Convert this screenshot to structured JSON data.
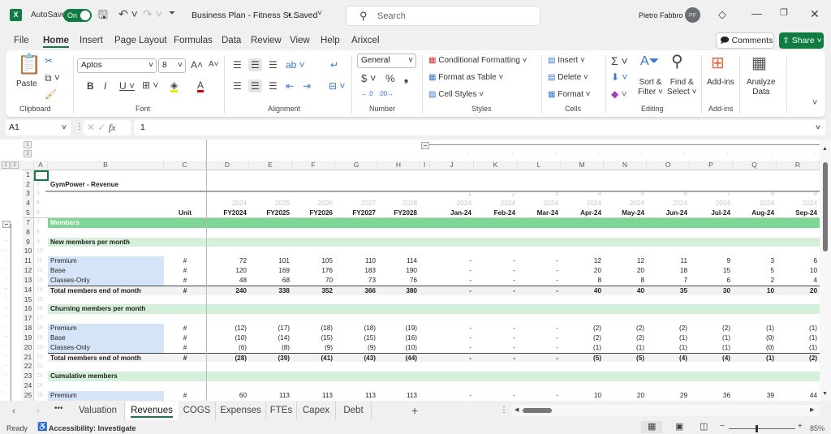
{
  "titlebar": {
    "autosave": "AutoSave",
    "toggle": "On",
    "doc_title": "Business Plan - Fitness St...",
    "saved": "• Saved",
    "search_placeholder": "Search",
    "user": "Pietro Fabbro",
    "initials": "PF"
  },
  "menu": [
    "File",
    "Home",
    "Insert",
    "Page Layout",
    "Formulas",
    "Data",
    "Review",
    "View",
    "Help",
    "Arixcel"
  ],
  "menu_active": "Home",
  "actions": {
    "comments": "Comments",
    "share": "Share"
  },
  "ribbon": {
    "clipboard": {
      "paste": "Paste",
      "label": "Clipboard"
    },
    "font": {
      "name": "Aptos",
      "size": "8",
      "label": "Font"
    },
    "alignment": {
      "label": "Alignment"
    },
    "number": {
      "format": "General",
      "label": "Number"
    },
    "styles": {
      "conditional": "Conditional Formatting",
      "table": "Format as Table",
      "cell": "Cell Styles",
      "label": "Styles"
    },
    "cells": {
      "insert": "Insert",
      "delete": "Delete",
      "format": "Format",
      "label": "Cells"
    },
    "editing": {
      "sort1": "Sort &",
      "sort2": "Filter",
      "find1": "Find &",
      "find2": "Select",
      "label": "Editing"
    },
    "addins": {
      "btn": "Add-ins",
      "label": "Add-ins"
    },
    "analyze": {
      "l1": "Analyze",
      "l2": "Data"
    }
  },
  "formula_bar": {
    "name_box": "A1",
    "formula": "1"
  },
  "outline": {
    "col_levels": [
      "1",
      "2"
    ],
    "row_levels": [
      "1",
      "2"
    ]
  },
  "columns": [
    "A",
    "B",
    "C",
    "D",
    "E",
    "F",
    "G",
    "H",
    "I",
    "J",
    "K",
    "L",
    "M",
    "N",
    "O",
    "P",
    "Q",
    "R"
  ],
  "rows": [
    {
      "n": "1",
      "type": "blank",
      "label": "",
      "unit": "",
      "v": []
    },
    {
      "n": "2",
      "type": "title",
      "label": "GymPower - Revenue",
      "unit": "",
      "v": []
    },
    {
      "n": "3",
      "type": "gray",
      "label": "",
      "unit": "",
      "v": [
        "",
        "",
        "",
        "",
        "",
        "",
        "1",
        "2",
        "3",
        "4",
        "5",
        "6",
        "7",
        "8",
        "9"
      ]
    },
    {
      "n": "4",
      "type": "gray",
      "label": "",
      "unit": "",
      "v": [
        "2024",
        "2025",
        "2026",
        "2027",
        "2028",
        "",
        "2024",
        "2024",
        "2024",
        "2024",
        "2024",
        "2024",
        "2024",
        "2024",
        "2024"
      ]
    },
    {
      "n": "5",
      "type": "head",
      "label": "",
      "unit": "Unit",
      "v": [
        "FY2024",
        "FY2025",
        "FY2026",
        "FY2027",
        "FY2028",
        "",
        "Jan-24",
        "Feb-24",
        "Mar-24",
        "Apr-24",
        "May-24",
        "Jun-24",
        "Jul-24",
        "Aug-24",
        "Sep-24"
      ]
    },
    {
      "n": "7",
      "type": "section",
      "label": "Members",
      "unit": "",
      "v": []
    },
    {
      "n": "8",
      "type": "blank",
      "label": "",
      "unit": "",
      "v": []
    },
    {
      "n": "9",
      "type": "sub",
      "label": "New members per month",
      "unit": "",
      "v": []
    },
    {
      "n": "10",
      "type": "blank",
      "label": "",
      "unit": "",
      "v": []
    },
    {
      "n": "11",
      "type": "item",
      "label": "Premium",
      "unit": "#",
      "v": [
        "72",
        "101",
        "105",
        "110",
        "114",
        "",
        "-",
        "-",
        "-",
        "12",
        "12",
        "11",
        "9",
        "3",
        "6"
      ]
    },
    {
      "n": "12",
      "type": "item",
      "label": "Base",
      "unit": "#",
      "v": [
        "120",
        "169",
        "176",
        "183",
        "190",
        "",
        "-",
        "-",
        "-",
        "20",
        "20",
        "18",
        "15",
        "5",
        "10"
      ]
    },
    {
      "n": "13",
      "type": "item",
      "label": "Classes-Only",
      "unit": "#",
      "v": [
        "48",
        "68",
        "70",
        "73",
        "76",
        "",
        "-",
        "-",
        "-",
        "8",
        "8",
        "7",
        "6",
        "2",
        "4"
      ]
    },
    {
      "n": "14",
      "type": "total",
      "label": "Total members end of month",
      "unit": "#",
      "v": [
        "240",
        "338",
        "352",
        "366",
        "380",
        "",
        "-",
        "-",
        "-",
        "40",
        "40",
        "35",
        "30",
        "10",
        "20"
      ]
    },
    {
      "n": "15",
      "type": "blank",
      "label": "",
      "unit": "",
      "v": []
    },
    {
      "n": "16",
      "type": "sub",
      "label": "Churning members per month",
      "unit": "",
      "v": []
    },
    {
      "n": "17",
      "type": "blank",
      "label": "",
      "unit": "",
      "v": []
    },
    {
      "n": "18",
      "type": "item",
      "label": "Premium",
      "unit": "#",
      "v": [
        "(12)",
        "(17)",
        "(18)",
        "(18)",
        "(19)",
        "",
        "-",
        "-",
        "-",
        "(2)",
        "(2)",
        "(2)",
        "(2)",
        "(1)",
        "(1)"
      ]
    },
    {
      "n": "19",
      "type": "item",
      "label": "Base",
      "unit": "#",
      "v": [
        "(10)",
        "(14)",
        "(15)",
        "(15)",
        "(16)",
        "",
        "-",
        "-",
        "-",
        "(2)",
        "(2)",
        "(1)",
        "(1)",
        "(0)",
        "(1)"
      ]
    },
    {
      "n": "20",
      "type": "item",
      "label": "Classes-Only",
      "unit": "#",
      "v": [
        "(6)",
        "(8)",
        "(9)",
        "(9)",
        "(10)",
        "",
        "-",
        "-",
        "-",
        "(1)",
        "(1)",
        "(1)",
        "(1)",
        "(0)",
        "(1)"
      ]
    },
    {
      "n": "21",
      "type": "total",
      "label": "Total members end of month",
      "unit": "#",
      "v": [
        "(28)",
        "(39)",
        "(41)",
        "(43)",
        "(44)",
        "",
        "-",
        "-",
        "-",
        "(5)",
        "(5)",
        "(4)",
        "(4)",
        "(1)",
        "(2)"
      ]
    },
    {
      "n": "22",
      "type": "blank",
      "label": "",
      "unit": "",
      "v": []
    },
    {
      "n": "23",
      "type": "sub",
      "label": "Cumulative members",
      "unit": "",
      "v": []
    },
    {
      "n": "24",
      "type": "blank",
      "label": "",
      "unit": "",
      "v": []
    },
    {
      "n": "25",
      "type": "item",
      "label": "Premium",
      "unit": "#",
      "v": [
        "60",
        "113",
        "113",
        "113",
        "113",
        "",
        "-",
        "-",
        "-",
        "10",
        "20",
        "29",
        "36",
        "39",
        "44"
      ]
    }
  ],
  "sheets": [
    "Valuation",
    "Revenues",
    "COGS",
    "Expenses",
    "FTEs",
    "Capex",
    "Debt"
  ],
  "active_sheet": "Revenues",
  "status": {
    "ready": "Ready",
    "accessibility": "Accessibility: Investigate",
    "zoom": "85%",
    "zoom_value": 85
  },
  "colors": {
    "excel_green": "#107c41",
    "section": "#7dd694",
    "subsection": "#d4f0da",
    "input": "#d6e4f8"
  }
}
